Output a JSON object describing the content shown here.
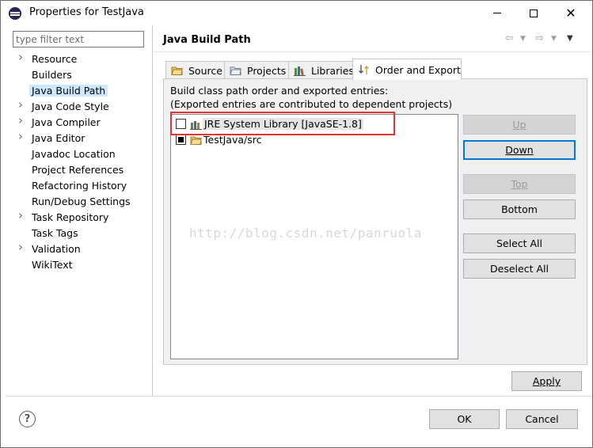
{
  "window": {
    "title": "Properties for TestJava"
  },
  "filter": {
    "placeholder": "type filter text"
  },
  "tree": [
    {
      "label": "Resource",
      "expandable": true
    },
    {
      "label": "Builders",
      "expandable": false
    },
    {
      "label": "Java Build Path",
      "expandable": false,
      "selected": true
    },
    {
      "label": "Java Code Style",
      "expandable": true
    },
    {
      "label": "Java Compiler",
      "expandable": true
    },
    {
      "label": "Java Editor",
      "expandable": true
    },
    {
      "label": "Javadoc Location",
      "expandable": false
    },
    {
      "label": "Project References",
      "expandable": false
    },
    {
      "label": "Refactoring History",
      "expandable": false
    },
    {
      "label": "Run/Debug Settings",
      "expandable": false
    },
    {
      "label": "Task Repository",
      "expandable": true
    },
    {
      "label": "Task Tags",
      "expandable": false
    },
    {
      "label": "Validation",
      "expandable": true
    },
    {
      "label": "WikiText",
      "expandable": false
    }
  ],
  "page": {
    "title": "Java Build Path"
  },
  "tabs": [
    {
      "label": "Source",
      "icon": "source-folder-icon"
    },
    {
      "label": "Projects",
      "icon": "projects-folder-icon"
    },
    {
      "label": "Libraries",
      "icon": "libraries-icon"
    },
    {
      "label": "Order and Export",
      "icon": "order-export-icon",
      "active": true
    }
  ],
  "order": {
    "desc1": "Build class path order and exported entries:",
    "desc2": "(Exported entries are contributed to dependent projects)",
    "entries": [
      {
        "label": "JRE System Library [JavaSE-1.8]",
        "checked": false,
        "icon": "jre-library-icon"
      },
      {
        "label": "TestJava/src",
        "checked": true,
        "icon": "source-folder-icon"
      }
    ]
  },
  "buttons": {
    "up": "Up",
    "down": "Down",
    "top": "Top",
    "bottom": "Bottom",
    "select_all": "Select All",
    "deselect_all": "Deselect All",
    "apply": "Apply",
    "ok": "OK",
    "cancel": "Cancel"
  },
  "watermark": "http://blog.csdn.net/panruola",
  "colors": {
    "selection": "#cce8ff",
    "focus": "#0078d7",
    "annotation": "#e23434"
  }
}
